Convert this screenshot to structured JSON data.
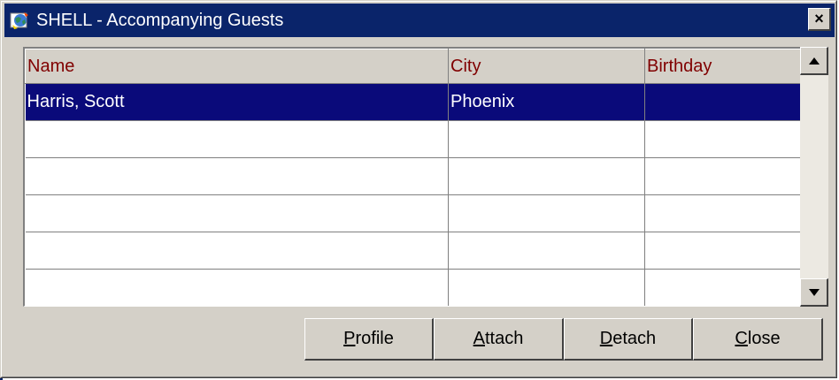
{
  "window": {
    "title": "SHELL - Accompanying Guests",
    "close_label": "×"
  },
  "grid": {
    "columns": [
      "Name",
      "City",
      "Birthday"
    ],
    "rows": [
      {
        "name": "Harris, Scott",
        "city": "Phoenix",
        "birthday": "",
        "selected": true
      },
      {
        "name": "",
        "city": "",
        "birthday": ""
      },
      {
        "name": "",
        "city": "",
        "birthday": ""
      },
      {
        "name": "",
        "city": "",
        "birthday": ""
      },
      {
        "name": "",
        "city": "",
        "birthday": ""
      },
      {
        "name": "",
        "city": "",
        "birthday": ""
      }
    ]
  },
  "buttons": {
    "profile": {
      "mnemonic": "P",
      "rest": "rofile"
    },
    "attach": {
      "mnemonic": "A",
      "rest": "ttach"
    },
    "detach": {
      "mnemonic": "D",
      "rest": "etach"
    },
    "close": {
      "mnemonic": "C",
      "rest": "lose"
    }
  },
  "colors": {
    "titlebar": "#0a246a",
    "header_text": "#800000",
    "selection": "#0a0a7a",
    "face": "#d4d0c8"
  },
  "icons": {
    "title": "app-globe-icon",
    "close": "close-icon",
    "scroll_up": "arrow-up-icon",
    "scroll_down": "arrow-down-icon"
  }
}
